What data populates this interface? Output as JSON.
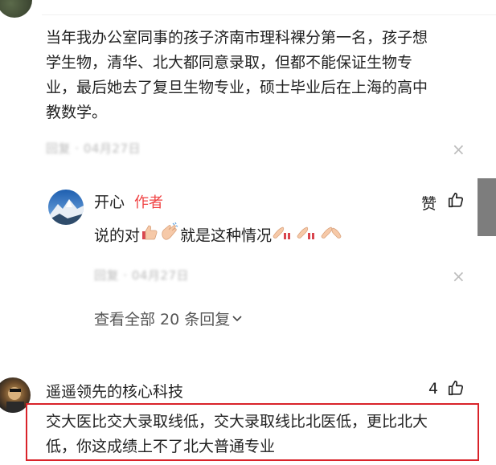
{
  "comment1": {
    "text_lines": [
      "当年我办公室同事的孩子济南市理科裸分第一名，孩子想",
      "学生物，清华、北大都同意录取，但都不能保证生物专",
      "业，最后她去了复旦生物专业，硕士毕业后在上海的高中",
      "教数学。"
    ],
    "reply_label": "回复",
    "date": "04月27日"
  },
  "reply": {
    "username": "开心",
    "author_tag": "作者",
    "like_label": "赞",
    "text_before": "说的对",
    "text_middle": "就是这种情况",
    "reply_label": "回复",
    "date": "04月27日",
    "view_all": "查看全部 20 条回复"
  },
  "comment2": {
    "username": "遥遥领先的核心科技",
    "like_count": "4",
    "text_lines": [
      "交大医比交大录取线低，交大录取线比北医低，更比北大",
      "低，你这成绩上不了北大普通专业"
    ]
  },
  "icons": {
    "close": "close-icon",
    "like": "thumbs-up-icon",
    "chevron": "chevron-down-icon"
  },
  "colors": {
    "author_tag": "#f04142",
    "highlight_border": "#d9232a",
    "scrollbar": "#7d7d7d"
  }
}
